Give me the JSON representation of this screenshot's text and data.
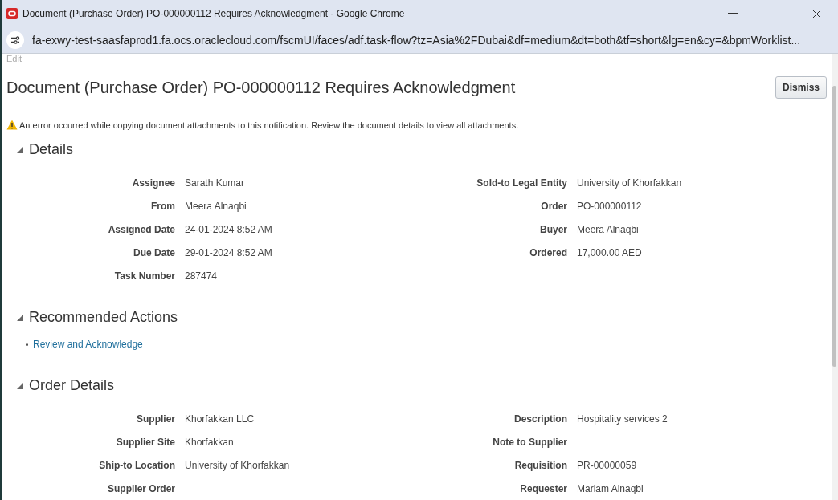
{
  "window": {
    "title": "Document (Purchase Order) PO-000000112 Requires Acknowledgment - Google Chrome",
    "url": "fa-exwy-test-saasfaprod1.fa.ocs.oraclecloud.com/fscmUI/faces/adf.task-flow?tz=Asia%2FDubai&df=medium&dt=both&tf=short&lg=en&cy=&bpmWorklist..."
  },
  "edit_label": "Edit",
  "page_title": "Document (Purchase Order) PO-000000112 Requires Acknowledgment",
  "dismiss_button": "Dismiss",
  "warning": "An error occurred while copying document attachments to this notification. Review the document details to view all attachments.",
  "sections": [
    {
      "title": "Details",
      "expanded": true,
      "kind": "fields",
      "left": [
        {
          "label": "Assignee",
          "value": "Sarath Kumar"
        },
        {
          "label": "From",
          "value": "Meera Alnaqbi"
        },
        {
          "label": "Assigned Date",
          "value": "24-01-2024 8:52 AM"
        },
        {
          "label": "Due Date",
          "value": "29-01-2024 8:52 AM"
        },
        {
          "label": "Task Number",
          "value": "287474"
        }
      ],
      "right": [
        {
          "label": "Sold-to Legal Entity",
          "value": "University of Khorfakkan"
        },
        {
          "label": "Order",
          "value": "PO-000000112"
        },
        {
          "label": "Buyer",
          "value": "Meera Alnaqbi"
        },
        {
          "label": "Ordered",
          "value": "17,000.00 AED"
        }
      ]
    },
    {
      "title": "Recommended Actions",
      "expanded": true,
      "kind": "links",
      "links": [
        "Review and Acknowledge"
      ]
    },
    {
      "title": "Order Details",
      "expanded": true,
      "kind": "fields",
      "left": [
        {
          "label": "Supplier",
          "value": "Khorfakkan LLC"
        },
        {
          "label": "Supplier Site",
          "value": "Khorfakkan"
        },
        {
          "label": "Ship-to Location",
          "value": "University of Khorfakkan"
        },
        {
          "label": "Supplier Order"
        }
      ],
      "right": [
        {
          "label": "Description",
          "value": "Hospitality services 2"
        },
        {
          "label": "Note to Supplier"
        },
        {
          "label": "Requisition",
          "value": "PR-00000059"
        },
        {
          "label": "Requester",
          "value": "Mariam Alnaqbi"
        }
      ]
    }
  ]
}
